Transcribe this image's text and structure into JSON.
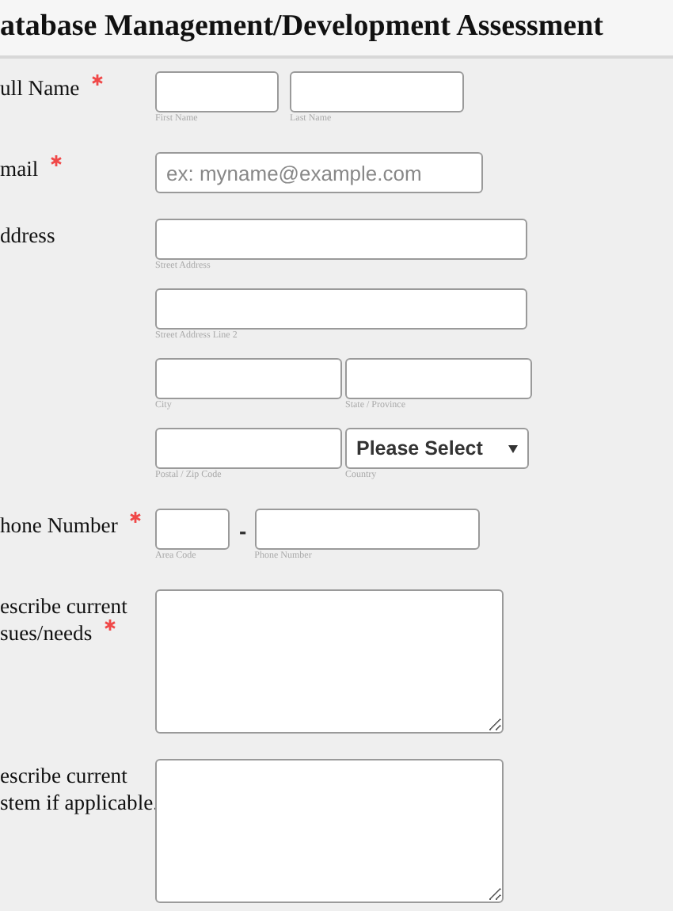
{
  "title": "atabase Management/Development Assessment",
  "fields": [
    {
      "kind": "name",
      "label": "ull Name",
      "required": true,
      "rows": [
        [
          {
            "kind": "text",
            "sublabel": "First Name"
          },
          {
            "kind": "text",
            "sublabel": "Last Name"
          }
        ]
      ]
    },
    {
      "kind": "email",
      "label": "mail",
      "required": true,
      "rows": [
        [
          {
            "kind": "text",
            "placeholder": "ex: myname@example.com"
          }
        ]
      ]
    },
    {
      "kind": "address",
      "label": "ddress",
      "required": false,
      "rows": [
        [
          {
            "kind": "text",
            "sublabel": "Street Address"
          }
        ],
        [
          {
            "kind": "text",
            "sublabel": "Street Address Line 2"
          }
        ],
        [
          {
            "kind": "text",
            "sublabel": "City"
          },
          {
            "kind": "text",
            "sublabel": "State / Province"
          }
        ],
        [
          {
            "kind": "text",
            "sublabel": "Postal / Zip Code"
          },
          {
            "kind": "select",
            "value": "Please Select",
            "sublabel": "Country"
          }
        ]
      ]
    },
    {
      "kind": "phone",
      "label": "hone Number",
      "required": true,
      "separator": "-",
      "rows": [
        [
          {
            "kind": "text",
            "sublabel": "Area Code"
          },
          {
            "kind": "text",
            "sublabel": "Phone Number"
          }
        ]
      ]
    },
    {
      "kind": "textarea",
      "label": "escribe current\nsues/needs",
      "required": true,
      "rows": [
        [
          {
            "kind": "textarea"
          }
        ]
      ]
    },
    {
      "kind": "textarea",
      "label": "escribe current\nstem if applicable.",
      "required": false,
      "rows": [
        [
          {
            "kind": "textarea"
          }
        ]
      ]
    }
  ]
}
